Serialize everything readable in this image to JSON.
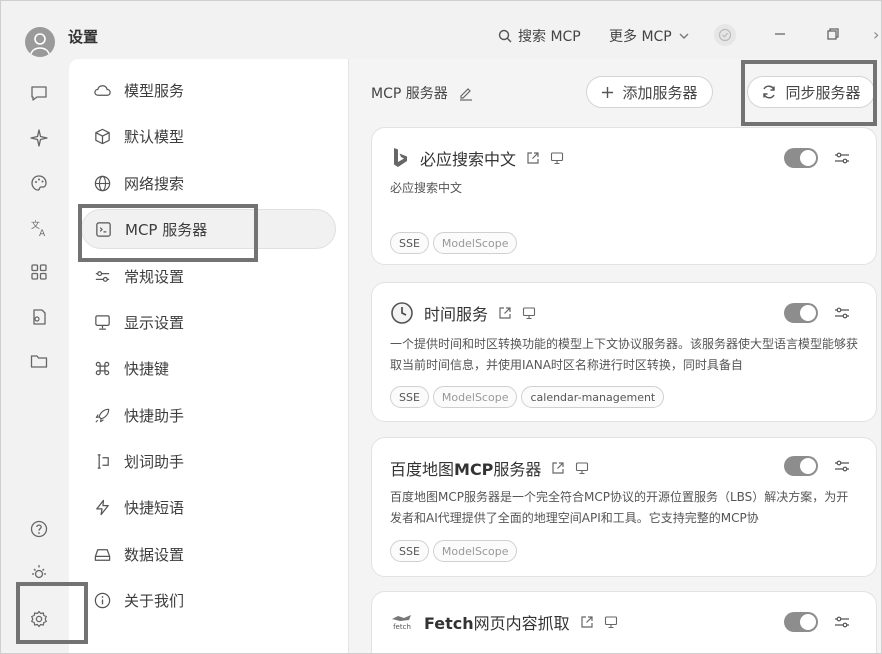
{
  "window": {
    "title": "设置",
    "search_label": "搜索 MCP",
    "more_label": "更多 MCP"
  },
  "nav": {
    "items": [
      {
        "label": "模型服务",
        "icon": "cloud-icon"
      },
      {
        "label": "默认模型",
        "icon": "cube-icon"
      },
      {
        "label": "网络搜索",
        "icon": "globe-icon"
      },
      {
        "label": "MCP 服务器",
        "icon": "terminal-icon"
      },
      {
        "label": "常规设置",
        "icon": "sliders-icon"
      },
      {
        "label": "显示设置",
        "icon": "monitor-icon"
      },
      {
        "label": "快捷键",
        "icon": "command-icon"
      },
      {
        "label": "快捷助手",
        "icon": "rocket-icon"
      },
      {
        "label": "划词助手",
        "icon": "text-cursor-icon"
      },
      {
        "label": "快捷短语",
        "icon": "zap-icon"
      },
      {
        "label": "数据设置",
        "icon": "drive-icon"
      },
      {
        "label": "关于我们",
        "icon": "info-icon"
      }
    ],
    "active_index": 3
  },
  "main": {
    "title": "MCP 服务器",
    "add_button": "添加服务器",
    "sync_button": "同步服务器",
    "servers": [
      {
        "name": "必应搜索中文",
        "description": "必应搜索中文",
        "tags": [
          "SSE",
          "ModelScope"
        ],
        "enabled": true
      },
      {
        "name": "时间服务",
        "description": "一个提供时间和时区转换功能的模型上下文协议服务器。该服务器使大型语言模型能够获取当前时间信息，并使用IANA时区名称进行时区转换，同时具备自",
        "tags": [
          "SSE",
          "ModelScope",
          "calendar-management"
        ],
        "enabled": true
      },
      {
        "name_prefix": "百度地图",
        "name_bold": "MCP",
        "name_suffix": "服务器",
        "description": "百度地图MCP服务器是一个完全符合MCP协议的开源位置服务（LBS）解决方案，为开发者和AI代理提供了全面的地理空间API和工具。它支持完整的MCP协",
        "tags": [
          "SSE",
          "ModelScope"
        ],
        "enabled": true
      },
      {
        "name_bold": "Fetch",
        "name_suffix": "网页内容抓取",
        "logo_text": "fetch",
        "enabled": true
      }
    ]
  }
}
